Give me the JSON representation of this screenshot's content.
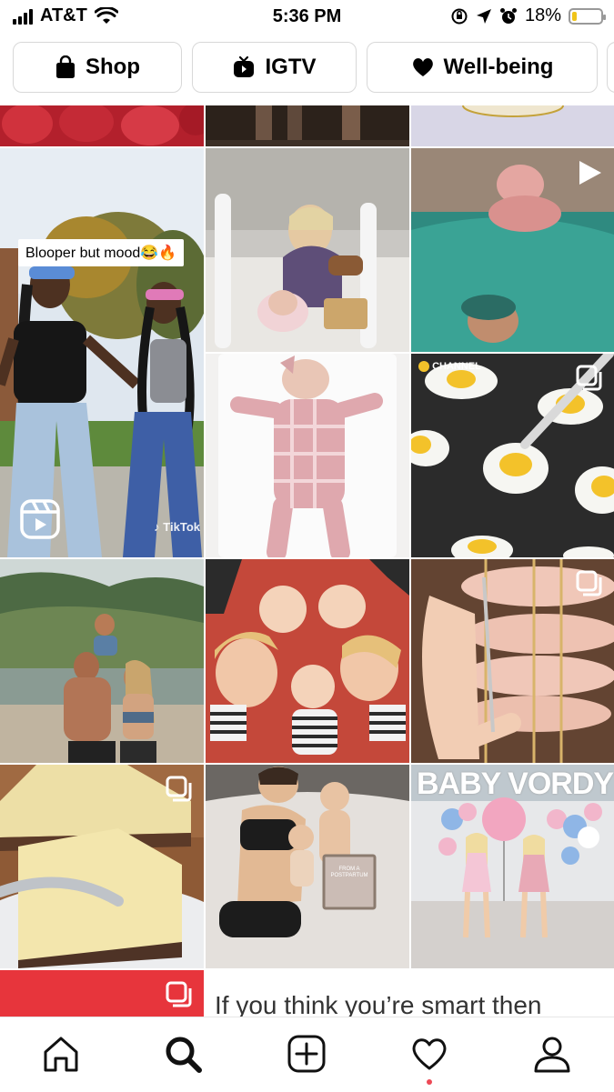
{
  "status_bar": {
    "carrier": "AT&T",
    "time": "5:36 PM",
    "battery_percent": "18%",
    "battery_level": 0.18,
    "battery_color": "#f0c419"
  },
  "topic_chips": [
    {
      "label": "Shop",
      "icon": "shopping-bag-icon"
    },
    {
      "label": "IGTV",
      "icon": "igtv-icon"
    },
    {
      "label": "Well-being",
      "icon": "heart-icon"
    }
  ],
  "grid": {
    "video_caption": "Blooper but mood😂🔥",
    "video_watermark": "TikTok",
    "tile_8_text": "CHANNEL",
    "tile_15_text": "BABY VORDY",
    "sign_text": "FROM A POSTPARTUM",
    "preview_text": "If you think you’re smart then"
  },
  "tab_bar": {
    "items": [
      "home-icon",
      "search-icon",
      "new-post-icon",
      "activity-heart-icon",
      "profile-icon"
    ],
    "active": "search-icon",
    "notification_dot_color": "#ed4956"
  }
}
